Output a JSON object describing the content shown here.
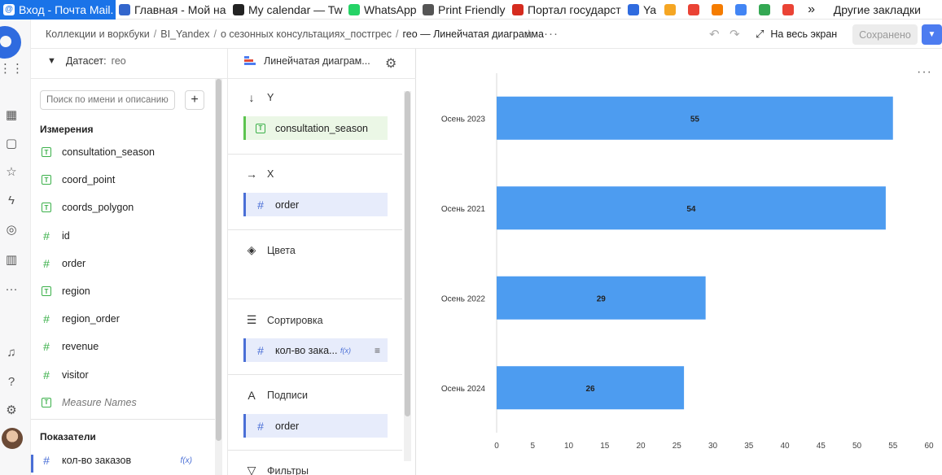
{
  "bookmarks": [
    {
      "label": "Вход - Почта Mail.",
      "icon": "mail-icon",
      "color": "#1a73e8",
      "active": true
    },
    {
      "label": "Главная - Мой на",
      "icon": "globe-icon",
      "color": "#3366cc"
    },
    {
      "label": "My calendar — Tw",
      "icon": "bookmark-icon",
      "color": "#222222"
    },
    {
      "label": "WhatsApp",
      "icon": "whatsapp-icon",
      "color": "#25d366"
    },
    {
      "label": "Print Friendly",
      "icon": "page-icon",
      "color": "#555555"
    },
    {
      "label": "Портал государст",
      "icon": "flag-icon",
      "color": "#d52b1e"
    },
    {
      "label": "Ya",
      "icon": "yandex-icon",
      "color": "#2f6bdf"
    },
    {
      "label": "",
      "icon": "mail-envelope-icon",
      "color": "#f5a623"
    },
    {
      "label": "",
      "icon": "app-icon",
      "color": "#ea4335"
    },
    {
      "label": "",
      "icon": "app-icon",
      "color": "#f57c00"
    },
    {
      "label": "",
      "icon": "google-icon",
      "color": "#4285f4"
    },
    {
      "label": "",
      "icon": "google-icon",
      "color": "#34a853"
    },
    {
      "label": "",
      "icon": "search-app-icon",
      "color": "#ea4335"
    }
  ],
  "bookmarks_more": "»",
  "other_bookmarks": "Другие закладки",
  "breadcrumbs": [
    "Коллекции и воркбуки",
    "BI_Yandex",
    "о сезонных консультациях_постгрес"
  ],
  "breadcrumb_current": "гео — Линейчатая диаграмма",
  "fullscreen_label": "На весь экран",
  "saved_label": "Сохранено",
  "dataset": {
    "label": "Датасет:",
    "value": "гео",
    "search_placeholder": "Поиск по имени и описанию",
    "dimensions_title": "Измерения",
    "dimensions": [
      {
        "name": "consultation_season",
        "type": "T"
      },
      {
        "name": "coord_point",
        "type": "T"
      },
      {
        "name": "coords_polygon",
        "type": "T"
      },
      {
        "name": "id",
        "type": "#"
      },
      {
        "name": "order",
        "type": "#"
      },
      {
        "name": "region",
        "type": "T"
      },
      {
        "name": "region_order",
        "type": "#"
      },
      {
        "name": "revenue",
        "type": "#"
      },
      {
        "name": "visitor",
        "type": "#"
      },
      {
        "name": "Measure Names",
        "type": "T"
      }
    ],
    "measures_title": "Показатели",
    "measures": [
      {
        "name": "кол-во заказов",
        "type": "#",
        "fx": "f(x)"
      }
    ]
  },
  "config": {
    "chart_type": "Линейчатая диаграм...",
    "sections": [
      {
        "icon": "arrow-down-icon",
        "glyph": "↓",
        "label": "Y",
        "chips": [
          {
            "kind": "dim",
            "type": "T",
            "label": "consultation_season"
          }
        ]
      },
      {
        "icon": "arrow-right-icon",
        "glyph": "→",
        "label": "X",
        "chips": [
          {
            "kind": "mea",
            "type": "#",
            "label": "order"
          }
        ]
      },
      {
        "icon": "paint-bucket-icon",
        "glyph": "◈",
        "label": "Цвета",
        "chips": []
      },
      {
        "icon": "sort-icon",
        "glyph": "☰",
        "label": "Сортировка",
        "chips": [
          {
            "kind": "mea",
            "type": "#",
            "label": "кол-во зака...",
            "fx": "f(x)",
            "sort": "≡"
          }
        ]
      },
      {
        "icon": "label-a-icon",
        "glyph": "A",
        "label": "Подписи",
        "chips": [
          {
            "kind": "mea",
            "type": "#",
            "label": "order"
          }
        ]
      },
      {
        "icon": "filter-icon",
        "glyph": "▽",
        "label": "Фильтры",
        "chips": []
      }
    ]
  },
  "chart_data": {
    "type": "bar",
    "orientation": "horizontal",
    "categories": [
      "Осень 2023",
      "Осень 2021",
      "Осень 2022",
      "Осень 2024"
    ],
    "values": [
      55,
      54,
      29,
      26
    ],
    "data_labels": [
      "55",
      "54",
      "29",
      "26"
    ],
    "xlim": [
      0,
      60
    ],
    "xticks": [
      0,
      5,
      10,
      15,
      20,
      25,
      30,
      35,
      40,
      45,
      50,
      55,
      60
    ],
    "bar_color": "#4d9cf0",
    "title": "",
    "xlabel": "",
    "ylabel": ""
  }
}
